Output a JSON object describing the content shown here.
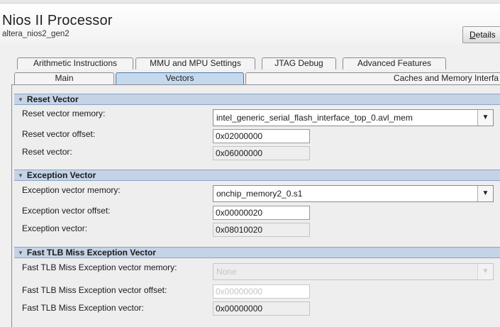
{
  "header": {
    "title": "Nios II Processor",
    "subtitle": "altera_nios2_gen2",
    "details_button": "Details"
  },
  "tabs": {
    "row_top": [
      "Arithmetic Instructions",
      "MMU and MPU Settings",
      "JTAG Debug",
      "Advanced Features"
    ],
    "row_front": [
      "Main",
      "Vectors",
      "Caches and Memory Interfa"
    ],
    "selected": "Vectors"
  },
  "reset_vector": {
    "section_title": "Reset Vector",
    "memory_label": "Reset vector memory:",
    "memory_value": "intel_generic_serial_flash_interface_top_0.avl_mem",
    "offset_label": "Reset vector offset:",
    "offset_value": "0x02000000",
    "vector_label": "Reset vector:",
    "vector_value": "0x06000000"
  },
  "exception_vector": {
    "section_title": "Exception Vector",
    "memory_label": "Exception vector memory:",
    "memory_value": "onchip_memory2_0.s1",
    "offset_label": "Exception vector offset:",
    "offset_value": "0x00000020",
    "vector_label": "Exception vector:",
    "vector_value": "0x08010020"
  },
  "fast_tlb": {
    "section_title": "Fast TLB Miss Exception Vector",
    "memory_label": "Fast TLB Miss Exception vector memory:",
    "memory_value": "None",
    "offset_label": "Fast TLB Miss Exception vector offset:",
    "offset_value": "0x00000000",
    "vector_label": "Fast TLB Miss Exception vector:",
    "vector_value": "0x00000000"
  },
  "icons": {
    "collapse": "triangle-down-icon",
    "dropdown": "chevron-down-icon"
  },
  "colors": {
    "section_header_bg": "#c4d3e6",
    "selected_tab_bg": "#c4d8ee"
  }
}
